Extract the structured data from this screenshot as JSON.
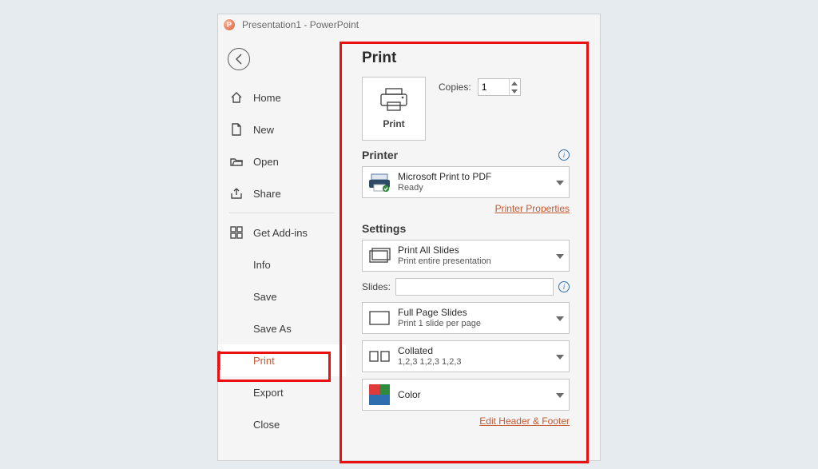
{
  "title": "Presentation1  -  PowerPoint",
  "nav": {
    "home": "Home",
    "new": "New",
    "open": "Open",
    "share": "Share",
    "addins": "Get Add-ins",
    "info": "Info",
    "save": "Save",
    "saveas": "Save As",
    "print": "Print",
    "export": "Export",
    "close": "Close"
  },
  "print": {
    "heading": "Print",
    "big_button": "Print",
    "copies_label": "Copies:",
    "copies_value": "1",
    "printer_heading": "Printer",
    "printer_name": "Microsoft Print to PDF",
    "printer_status": "Ready",
    "printer_properties": "Printer Properties",
    "settings_heading": "Settings",
    "range_main": "Print All Slides",
    "range_sub": "Print entire presentation",
    "slides_label": "Slides:",
    "layout_main": "Full Page Slides",
    "layout_sub": "Print 1 slide per page",
    "collate_main": "Collated",
    "collate_sub": "1,2,3    1,2,3    1,2,3",
    "color_main": "Color",
    "edit_hf": "Edit Header & Footer"
  }
}
